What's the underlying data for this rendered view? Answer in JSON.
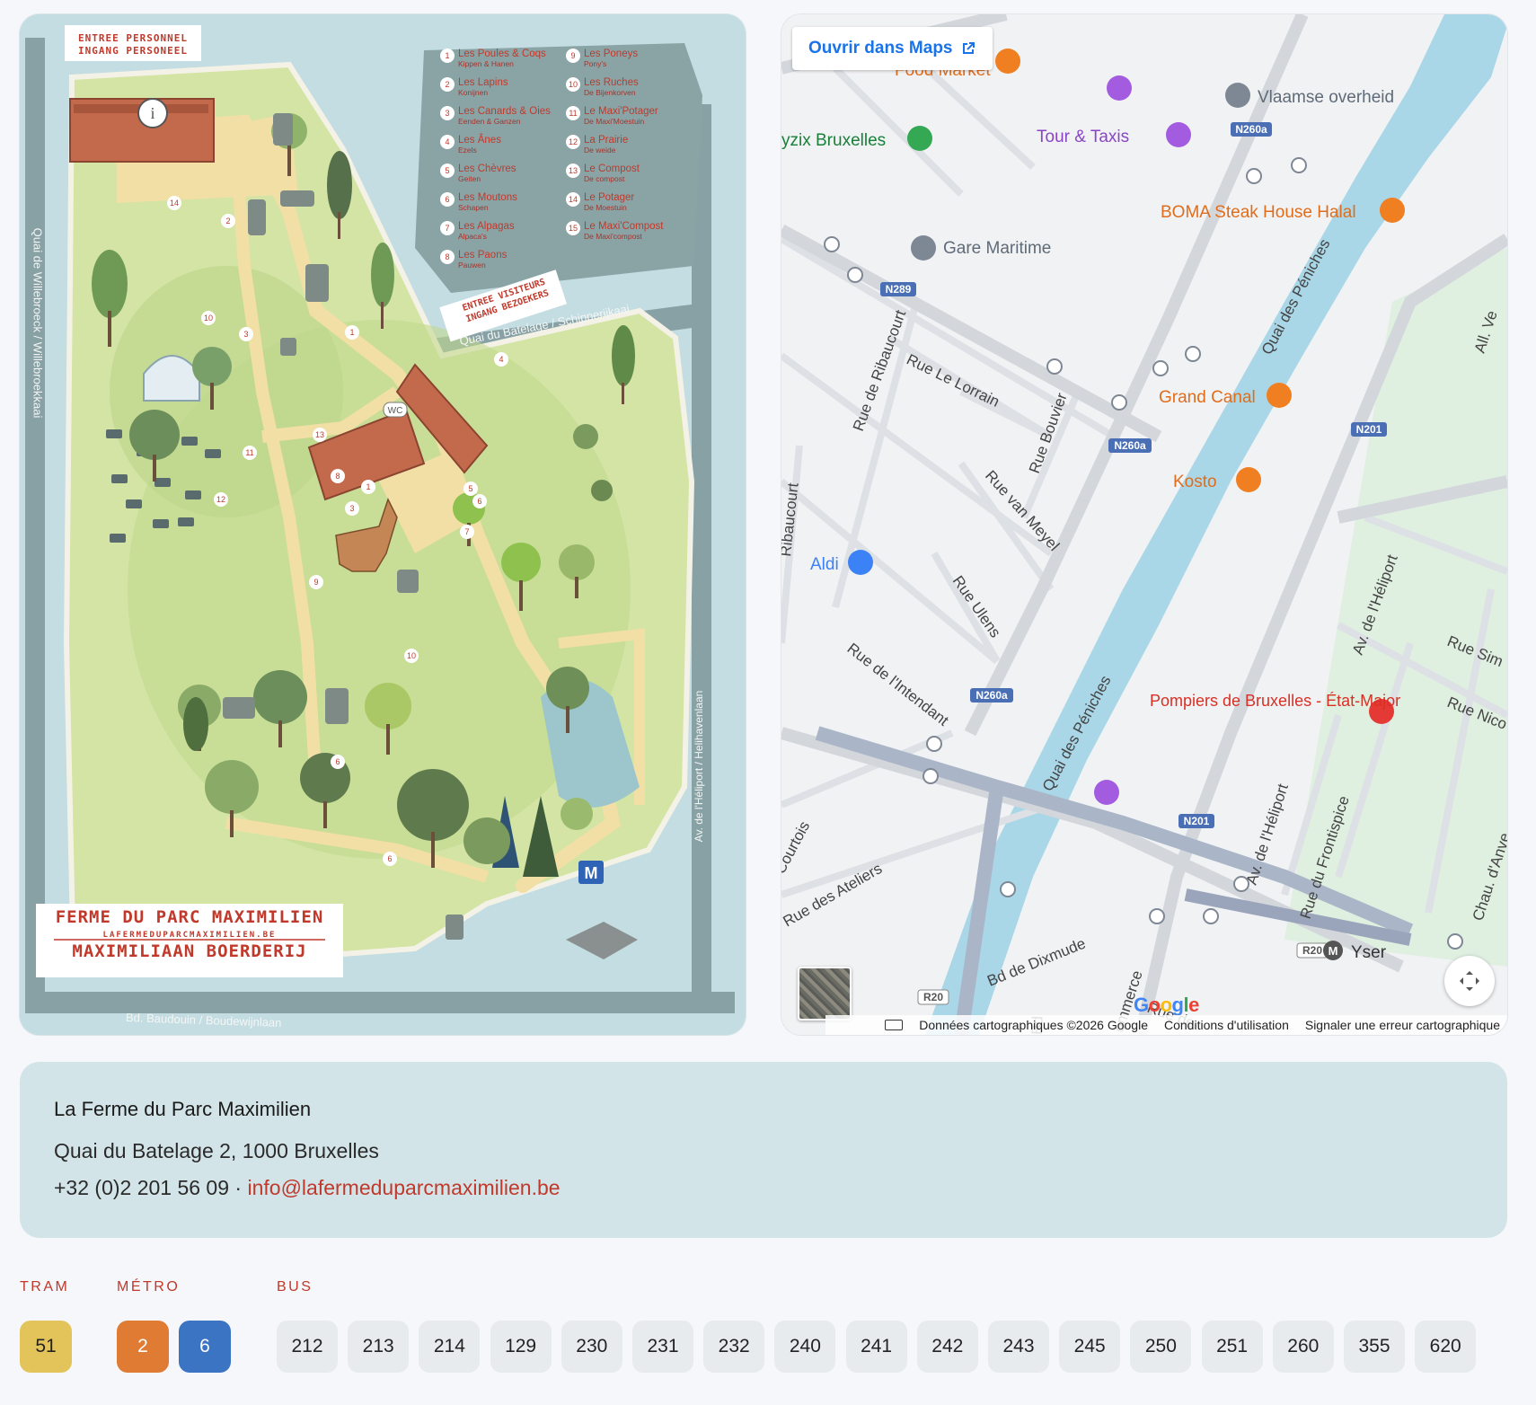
{
  "illustrated_map": {
    "staff_entrance": [
      "ENTREE PERSONNEL",
      "INGANG PERSONEEL"
    ],
    "visitor_entrance": [
      "ENTREE VISITEURS",
      "INGANG BEZOEKERS"
    ],
    "streets": {
      "west": "Quai de Willebroeck / Willebroekkaai",
      "north": "Quai du Batelage / Schipperijkaai",
      "east": "Av. de l'Héliport / Helihavenlaan",
      "south": "Bd. Baudouin / Boudewijnlaan"
    },
    "legend": [
      {
        "num": "1",
        "fr": "Les Poules & Coqs",
        "nl": "Kippen & Hanen"
      },
      {
        "num": "2",
        "fr": "Les Lapins",
        "nl": "Konijnen"
      },
      {
        "num": "3",
        "fr": "Les Canards & Oies",
        "nl": "Eenden & Ganzen"
      },
      {
        "num": "4",
        "fr": "Les Ânes",
        "nl": "Ezels"
      },
      {
        "num": "5",
        "fr": "Les Chèvres",
        "nl": "Geiten"
      },
      {
        "num": "6",
        "fr": "Les Moutons",
        "nl": "Schapen"
      },
      {
        "num": "7",
        "fr": "Les Alpagas",
        "nl": "Alpaca's"
      },
      {
        "num": "8",
        "fr": "Les Paons",
        "nl": "Pauwen"
      },
      {
        "num": "9",
        "fr": "Les Poneys",
        "nl": "Pony's"
      },
      {
        "num": "10",
        "fr": "Les Ruches",
        "nl": "De Bijenkorven"
      },
      {
        "num": "11",
        "fr": "Le Maxi'Potager",
        "nl": "De Maxi'Moestuin"
      },
      {
        "num": "12",
        "fr": "La Prairie",
        "nl": "De weide"
      },
      {
        "num": "13",
        "fr": "Le Compost",
        "nl": "De compost"
      },
      {
        "num": "14",
        "fr": "Le Potager",
        "nl": "De Moestuin"
      },
      {
        "num": "15",
        "fr": "Le Maxi'Compost",
        "nl": "De Maxi'compost"
      }
    ],
    "wc_label": "WC",
    "metro_letter": "M",
    "brand": {
      "title": "FERME DU PARC MAXIMILIEN",
      "url": "LAFERMEDUPARCMAXIMILIEN.BE",
      "subtitle": "MAXIMILIAAN BOERDERIJ"
    }
  },
  "google_map": {
    "open_button": "Ouvrir dans Maps",
    "footer": {
      "data": "Données cartographiques ©2026 Google",
      "terms": "Conditions d'utilisation",
      "report": "Signaler une erreur cartographique"
    },
    "watermark": "Google",
    "pois": [
      {
        "name": "Food Market",
        "kind": "restaurant"
      },
      {
        "name": "Vlaamse overheid",
        "kind": "government"
      },
      {
        "name": "yzix Bruxelles",
        "kind": "place"
      },
      {
        "name": "Tour & Taxis",
        "kind": "venue"
      },
      {
        "name": "BOMA Steak House Halal",
        "kind": "restaurant"
      },
      {
        "name": "Gare Maritime",
        "kind": "landmark"
      },
      {
        "name": "Grand Canal",
        "kind": "bar"
      },
      {
        "name": "Kosto",
        "kind": "cafe"
      },
      {
        "name": "Aldi",
        "kind": "shop"
      },
      {
        "name": "Pompiers de Bruxelles - État-Major",
        "kind": "emergency"
      },
      {
        "name": "Yser",
        "kind": "metro"
      }
    ],
    "streets": [
      "Rue de Ribaucourt",
      "Rue Le Lorrain",
      "Rue Bouvier",
      "Rue van Meyel",
      "Rue Ulens",
      "Rue de l'Intendant",
      "Quai des Péniches",
      "Rue des Ateliers",
      "Bd de Dixmude",
      "Av. de l'Héliport",
      "Rue du Frontispice",
      "Courtois",
      "Ribaucourt",
      "Rue Sim",
      "Rue Nico",
      "Chau. d'Anve",
      "All. Ve",
      "Bd",
      "ommerce",
      "Rue de"
    ],
    "road_shields": [
      "N260a",
      "N289",
      "N201",
      "R20"
    ]
  },
  "info": {
    "name": "La Ferme du Parc Maximilien",
    "address": "Quai du Batelage 2, 1000 Bruxelles",
    "phone": "+32 (0)2 201 56 09",
    "separator": " · ",
    "email": "info@lafermeduparcmaximilien.be"
  },
  "transit": {
    "tram_label": "TRAM",
    "metro_label": "MÉTRO",
    "bus_label": "BUS",
    "tram": [
      {
        "line": "51",
        "color": "#e3c45b"
      }
    ],
    "metro": [
      {
        "line": "2",
        "color": "#e07b33"
      },
      {
        "line": "6",
        "color": "#3a74c2"
      }
    ],
    "bus": [
      "212",
      "213",
      "214",
      "129",
      "230",
      "231",
      "232",
      "240",
      "241",
      "242",
      "243",
      "245",
      "250",
      "251",
      "260",
      "355",
      "620"
    ]
  }
}
